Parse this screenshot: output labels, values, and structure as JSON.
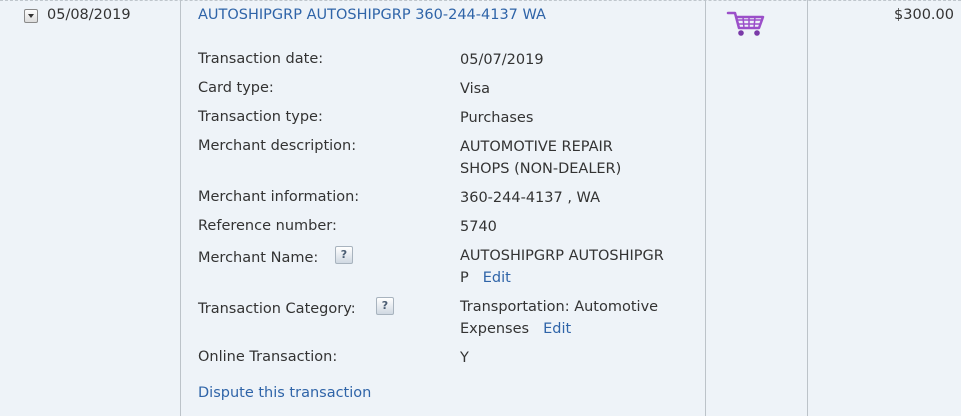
{
  "transaction": {
    "date": "05/08/2019",
    "description": "AUTOSHIPGRP AUTOSHIPGRP 360-244-4137 WA",
    "amount": "$300.00",
    "icon": "shopping-cart-icon"
  },
  "details": {
    "transaction_date_label": "Transaction date:",
    "transaction_date_value": "05/07/2019",
    "card_type_label": "Card type:",
    "card_type_value": "Visa",
    "transaction_type_label": "Transaction type:",
    "transaction_type_value": "Purchases",
    "merchant_description_label": "Merchant description:",
    "merchant_description_line1": "AUTOMOTIVE REPAIR",
    "merchant_description_line2": "SHOPS (NON-DEALER)",
    "merchant_information_label": "Merchant information:",
    "merchant_information_value": "360-244-4137 , WA",
    "reference_number_label": "Reference number:",
    "reference_number_value": "5740",
    "merchant_name_label": "Merchant Name:",
    "merchant_name_line1": "AUTOSHIPGRP AUTOSHIPGR",
    "merchant_name_line2": "P",
    "transaction_category_label": "Transaction Category:",
    "transaction_category_line1": "Transportation: Automotive",
    "transaction_category_line2": "Expenses",
    "online_transaction_label": "Online Transaction:",
    "online_transaction_value": "Y",
    "help_glyph": "?",
    "edit_label": "Edit"
  },
  "actions": {
    "dispute_label": "Dispute this transaction"
  },
  "colors": {
    "background": "#eef3f8",
    "link": "#2f64a8",
    "cart": "#9b4fc9"
  }
}
